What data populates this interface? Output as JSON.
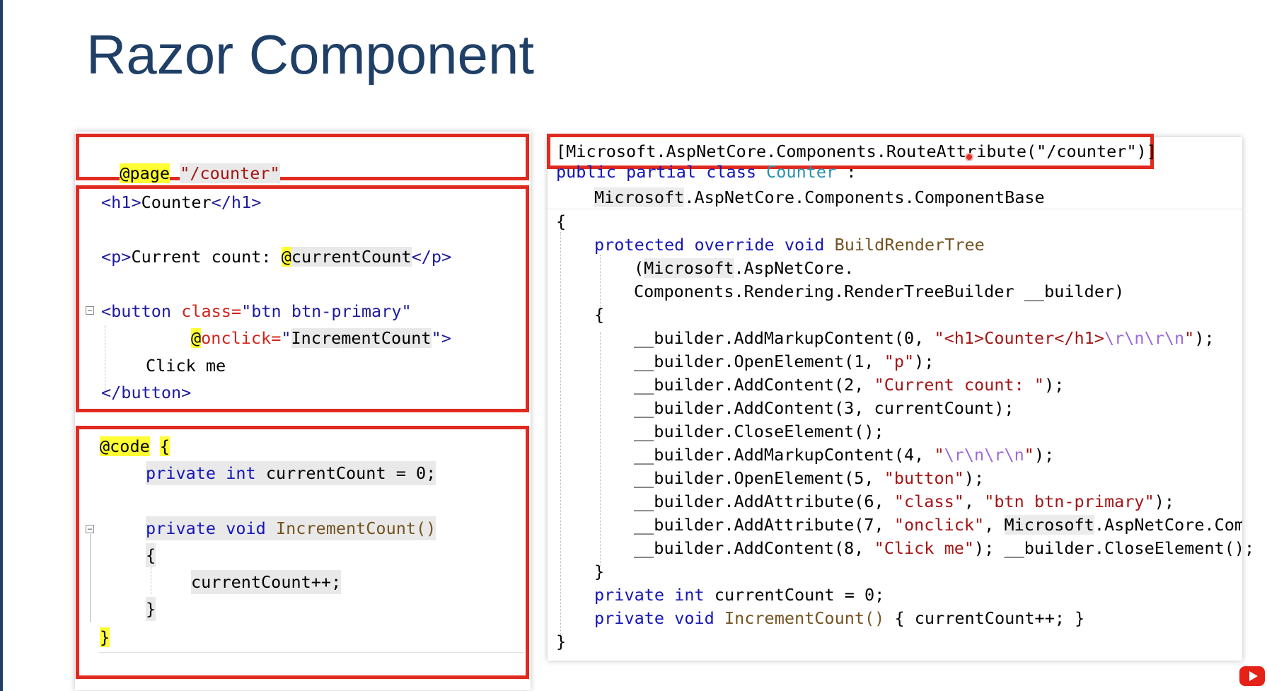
{
  "slide": {
    "title": "Razor Component"
  },
  "left_code": {
    "page_block": {
      "directive": "@page",
      "route": "\"/counter\""
    },
    "markup_block": {
      "h1_open": "<h1>",
      "h1_text": "Counter",
      "h1_close": "</h1>",
      "p_open": "<p>",
      "p_text": "Current count: ",
      "p_bind": "@currentCount",
      "p_close": "</p>",
      "btn_open": "<button",
      "btn_class_attr": "class=",
      "btn_class_val": "\"btn btn-primary\"",
      "btn_onclick_at": "@",
      "btn_onclick_attr": "onclick=",
      "btn_onclick_val": "\"IncrementCount\"",
      "btn_gt": "\">",
      "btn_text": "Click me",
      "btn_close": "</button>"
    },
    "code_block": {
      "directive": "@code",
      "brace_open": "{",
      "field_kw1": "private",
      "field_kw2": "int",
      "field_rest": "currentCount = 0;",
      "method_kw1": "private",
      "method_kw2": "void",
      "method_name": "IncrementCount()",
      "brace_inner_open": "{",
      "body": "currentCount++;",
      "brace_inner_close": "}",
      "brace_close": "}"
    }
  },
  "right_code": {
    "route_attr": "[Microsoft.AspNetCore.Components.RouteAttribute(\"/counter\")]",
    "class_decl": {
      "kw1": "public",
      "kw2": "partial",
      "kw3": "class",
      "name": "Counter",
      "colon": ":"
    },
    "base_ns": "Microsoft",
    "base_rest": ".AspNetCore.Components.ComponentBase",
    "open_brace": "{",
    "method_kw1": "protected",
    "method_kw2": "override",
    "method_kw3": "void",
    "method_name": "BuildRenderTree",
    "param_open": "(",
    "param_ns": "Microsoft",
    "param_rest1": ".AspNetCore.",
    "param_line2": "Components.Rendering.RenderTreeBuilder __builder)",
    "method_brace_open": "{",
    "lines": {
      "l1_pre": "__builder.AddMarkupContent(0, ",
      "l1_str": "\"<h1>Counter</h1>",
      "l1_esc": "\\r\\n\\r\\n",
      "l1_end_str": "\"",
      "l1_post": ");",
      "l2_pre": "__builder.OpenElement(1, ",
      "l2_str": "\"p\"",
      "l2_post": ");",
      "l3_pre": "__builder.AddContent(2, ",
      "l3_str": "\"Current count: \"",
      "l3_post": ");",
      "l4": "__builder.AddContent(3, currentCount);",
      "l5": "__builder.CloseElement();",
      "l6_pre": "__builder.AddMarkupContent(4, ",
      "l6_q1": "\"",
      "l6_esc": "\\r\\n\\r\\n",
      "l6_q2": "\"",
      "l6_post": ");",
      "l7_pre": "__builder.OpenElement(5, ",
      "l7_str": "\"button\"",
      "l7_post": ");",
      "l8_pre": "__builder.AddAttribute(6, ",
      "l8_str1": "\"class\"",
      "l8_mid": ", ",
      "l8_str2": "\"btn btn-primary\"",
      "l8_post": ");",
      "l9_pre": "__builder.AddAttribute(7, ",
      "l9_str": "\"onclick\"",
      "l9_mid": ", ",
      "l9_ns": "Microsoft",
      "l9_post": ".AspNetCore.Compo",
      "l10_pre": "__builder.AddContent(8, ",
      "l10_str": "\"Click me\"",
      "l10_post": "); __builder.CloseElement();"
    },
    "method_brace_close": "}",
    "field_kw1": "private",
    "field_kw2": "int",
    "field_rest": "currentCount = 0;",
    "m2_kw1": "private",
    "m2_kw2": "void",
    "m2_name": "IncrementCount()",
    "m2_rest": " { currentCount++; }",
    "close_brace": "}"
  },
  "colors": {
    "title": "#1f3f66",
    "box_border": "#e12a1f",
    "keyword": "#1515b8",
    "string": "#a31515",
    "directive_highlight": "#ffff33"
  }
}
